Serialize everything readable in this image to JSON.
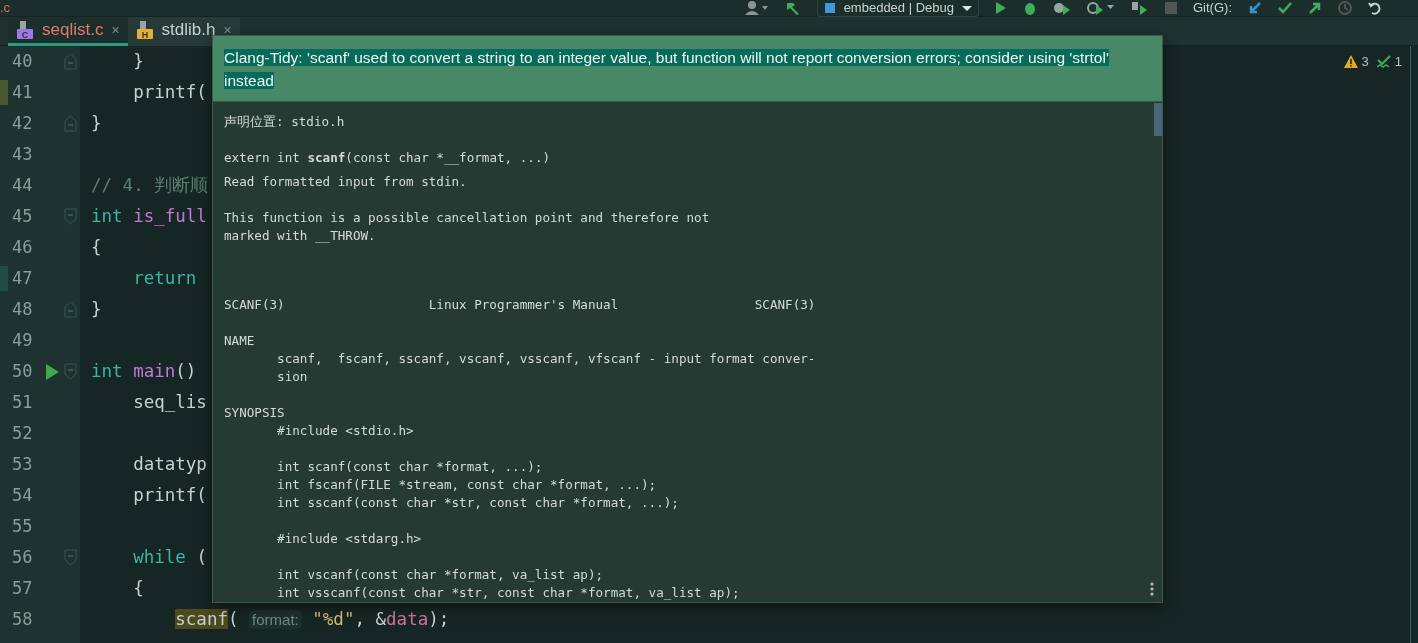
{
  "toolbar": {
    "file_fragment": ".c",
    "run_config": "embedded | Debug",
    "vcs_label": "Git(G):"
  },
  "tabs": [
    {
      "label": "seqlist.c",
      "icon_letter": "C",
      "close": "×",
      "selected": true,
      "error": true
    },
    {
      "label": "stdlib.h",
      "icon_letter": "H",
      "close": "×",
      "selected": false,
      "error": false
    }
  ],
  "inspections": [
    {
      "kind": "warning",
      "count": "3"
    },
    {
      "kind": "weak",
      "count": "1"
    }
  ],
  "lines": [
    {
      "number": "40",
      "fold_open": false,
      "fold_close": true,
      "modified": false,
      "added": false,
      "run": false,
      "tokens": [
        {
          "kind": "plain",
          "text": "    }"
        }
      ]
    },
    {
      "number": "41",
      "fold_open": false,
      "fold_close": false,
      "modified": true,
      "added": false,
      "run": false,
      "tokens": [
        {
          "kind": "plain",
          "text": "    printf("
        }
      ]
    },
    {
      "number": "42",
      "fold_open": false,
      "fold_close": true,
      "modified": false,
      "added": false,
      "run": false,
      "tokens": [
        {
          "kind": "plain",
          "text": "}"
        }
      ]
    },
    {
      "number": "43",
      "fold_open": false,
      "fold_close": false,
      "modified": false,
      "added": false,
      "run": false
    },
    {
      "number": "44",
      "fold_open": false,
      "fold_close": false,
      "modified": false,
      "added": false,
      "run": false,
      "tokens": [
        {
          "kind": "comment",
          "text": "// 4. 判断顺"
        }
      ]
    },
    {
      "number": "45",
      "fold_open": true,
      "fold_close": false,
      "modified": false,
      "added": false,
      "run": false,
      "tokens": [
        {
          "kind": "keyword",
          "text": "int"
        },
        {
          "kind": "func",
          "text": " is_full"
        }
      ]
    },
    {
      "number": "46",
      "fold_open": false,
      "fold_close": false,
      "modified": false,
      "added": false,
      "run": false,
      "tokens": [
        {
          "kind": "plain",
          "text": "{"
        }
      ]
    },
    {
      "number": "47",
      "fold_open": false,
      "fold_close": false,
      "modified": false,
      "added": true,
      "run": false,
      "tokens": [
        {
          "kind": "keyword",
          "text": "    return"
        }
      ]
    },
    {
      "number": "48",
      "fold_open": false,
      "fold_close": true,
      "modified": false,
      "added": false,
      "run": false,
      "tokens": [
        {
          "kind": "plain",
          "text": "}"
        }
      ]
    },
    {
      "number": "49",
      "fold_open": false,
      "fold_close": false,
      "modified": false,
      "added": false,
      "run": false
    },
    {
      "number": "50",
      "fold_open": true,
      "fold_close": false,
      "modified": false,
      "added": false,
      "run": true,
      "tokens": [
        {
          "kind": "keyword",
          "text": "int"
        },
        {
          "kind": "func",
          "text": " main"
        },
        {
          "kind": "plain",
          "text": "()"
        }
      ]
    },
    {
      "number": "51",
      "fold_open": false,
      "fold_close": false,
      "modified": false,
      "added": false,
      "run": false,
      "tokens": [
        {
          "kind": "plain",
          "text": "    seq_lis"
        }
      ]
    },
    {
      "number": "52",
      "fold_open": false,
      "fold_close": false,
      "modified": false,
      "added": false,
      "run": false
    },
    {
      "number": "53",
      "fold_open": false,
      "fold_close": false,
      "modified": false,
      "added": false,
      "run": false,
      "tokens": [
        {
          "kind": "plain",
          "text": "    datatyp"
        }
      ]
    },
    {
      "number": "54",
      "fold_open": false,
      "fold_close": false,
      "modified": false,
      "added": false,
      "run": false,
      "tokens": [
        {
          "kind": "plain",
          "text": "    printf("
        }
      ]
    },
    {
      "number": "55",
      "fold_open": false,
      "fold_close": false,
      "modified": false,
      "added": false,
      "run": false
    },
    {
      "number": "56",
      "fold_open": true,
      "fold_close": false,
      "modified": false,
      "added": false,
      "run": false,
      "tokens": [
        {
          "kind": "keyword",
          "text": "    while"
        },
        {
          "kind": "plain",
          "text": " ("
        }
      ]
    },
    {
      "number": "57",
      "fold_open": false,
      "fold_close": false,
      "modified": false,
      "added": false,
      "run": false,
      "tokens": [
        {
          "kind": "plain",
          "text": "    {"
        }
      ]
    },
    {
      "number": "58",
      "fold_open": false,
      "fold_close": false,
      "modified": false,
      "added": false,
      "run": false,
      "tokens": [
        {
          "kind": "highlight",
          "text": "        scanf"
        },
        {
          "kind": "plain",
          "text": "( "
        },
        {
          "kind": "hint",
          "text": "format:"
        },
        {
          "kind": "string",
          "text": " \"%d\""
        },
        {
          "kind": "plain",
          "text": ", &"
        },
        {
          "kind": "var",
          "text": "data"
        },
        {
          "kind": "plain",
          "text": ");"
        }
      ]
    }
  ],
  "popup": {
    "message": "Clang-Tidy: 'scanf' used to convert a string to an integer value, but function will not report conversion errors; consider using 'strtol' instead",
    "declaration": "声明位置: stdio.h",
    "signature": "extern int **scanf**(const char *__format, ...)",
    "description": [
      {
        "lines": [
          "Read formatted input from stdin."
        ]
      },
      {
        "lines": [
          "This function is a possible cancellation point and therefore not",
          "marked with __THROW."
        ]
      }
    ],
    "man_page": [
      {
        "lines": [
          "SCANF(3)                   Linux Programmer's Manual                  SCANF(3)"
        ]
      },
      {
        "lines": [
          "NAME",
          "       scanf,  fscanf, sscanf, vscanf, vsscanf, vfscanf - input format conver-",
          "       sion"
        ]
      },
      {
        "lines": [
          "SYNOPSIS",
          "       #include <stdio.h>"
        ]
      },
      {
        "lines": [
          "       int scanf(const char *format, ...);",
          "       int fscanf(FILE *stream, const char *format, ...);",
          "       int sscanf(const char *str, const char *format, ...);"
        ]
      },
      {
        "lines": [
          "       #include <stdarg.h>"
        ]
      },
      {
        "lines": [
          "       int vscanf(const char *format, va_list ap);",
          "       int vsscanf(const char *str, const char *format, va_list ap);"
        ]
      }
    ]
  }
}
